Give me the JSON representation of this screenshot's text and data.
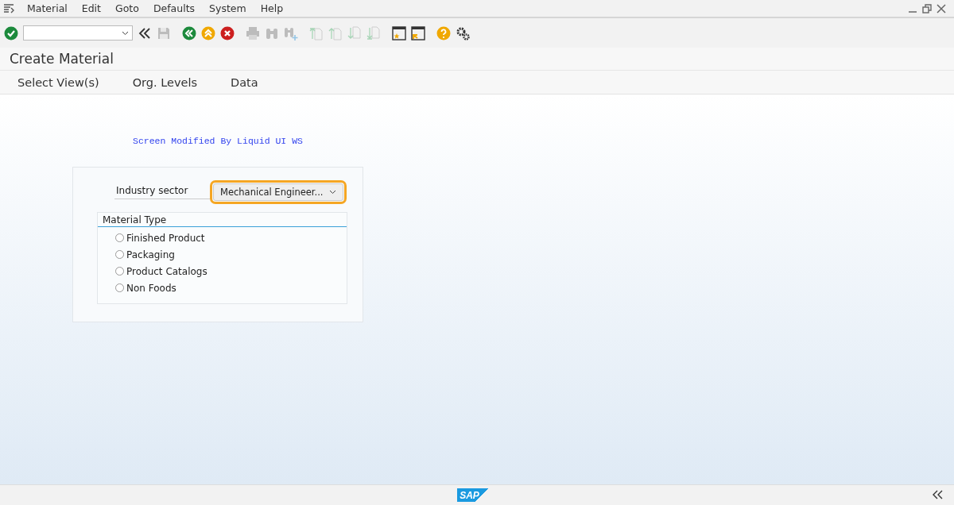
{
  "menu": [
    "Material",
    "Edit",
    "Goto",
    "Defaults",
    "System",
    "Help"
  ],
  "toolbar": [
    {
      "kind": "enter",
      "disabled": false
    },
    {
      "kind": "command",
      "disabled": false
    },
    {
      "kind": "collapse",
      "disabled": false
    },
    {
      "kind": "save",
      "disabled": true
    },
    {
      "kind": "back",
      "disabled": false
    },
    {
      "kind": "exit",
      "disabled": false
    },
    {
      "kind": "cancel",
      "disabled": false
    },
    {
      "kind": "print",
      "disabled": true
    },
    {
      "kind": "find",
      "disabled": true
    },
    {
      "kind": "findnext",
      "disabled": true
    },
    {
      "kind": "first",
      "disabled": true
    },
    {
      "kind": "prev",
      "disabled": true
    },
    {
      "kind": "next",
      "disabled": true
    },
    {
      "kind": "last",
      "disabled": true
    },
    {
      "kind": "newsession",
      "disabled": false
    },
    {
      "kind": "shortcut",
      "disabled": false
    },
    {
      "kind": "help",
      "disabled": false
    },
    {
      "kind": "settings",
      "disabled": false
    }
  ],
  "window": {
    "title": "Create Material"
  },
  "app_toolbar": [
    "Select View(s)",
    "Org. Levels",
    "Data"
  ],
  "notice": "Screen Modified By Liquid UI WS",
  "industry_sector": {
    "label": "Industry sector",
    "value": "Mechanical Engineer...",
    "focused": true
  },
  "material_type": {
    "title": "Material Type",
    "options": [
      {
        "label": "Finished Product",
        "selected": false
      },
      {
        "label": "Packaging",
        "selected": false
      },
      {
        "label": "Product Catalogs",
        "selected": false
      },
      {
        "label": "Non Foods",
        "selected": false
      }
    ]
  },
  "status_bar": {
    "logo": "SAP"
  }
}
